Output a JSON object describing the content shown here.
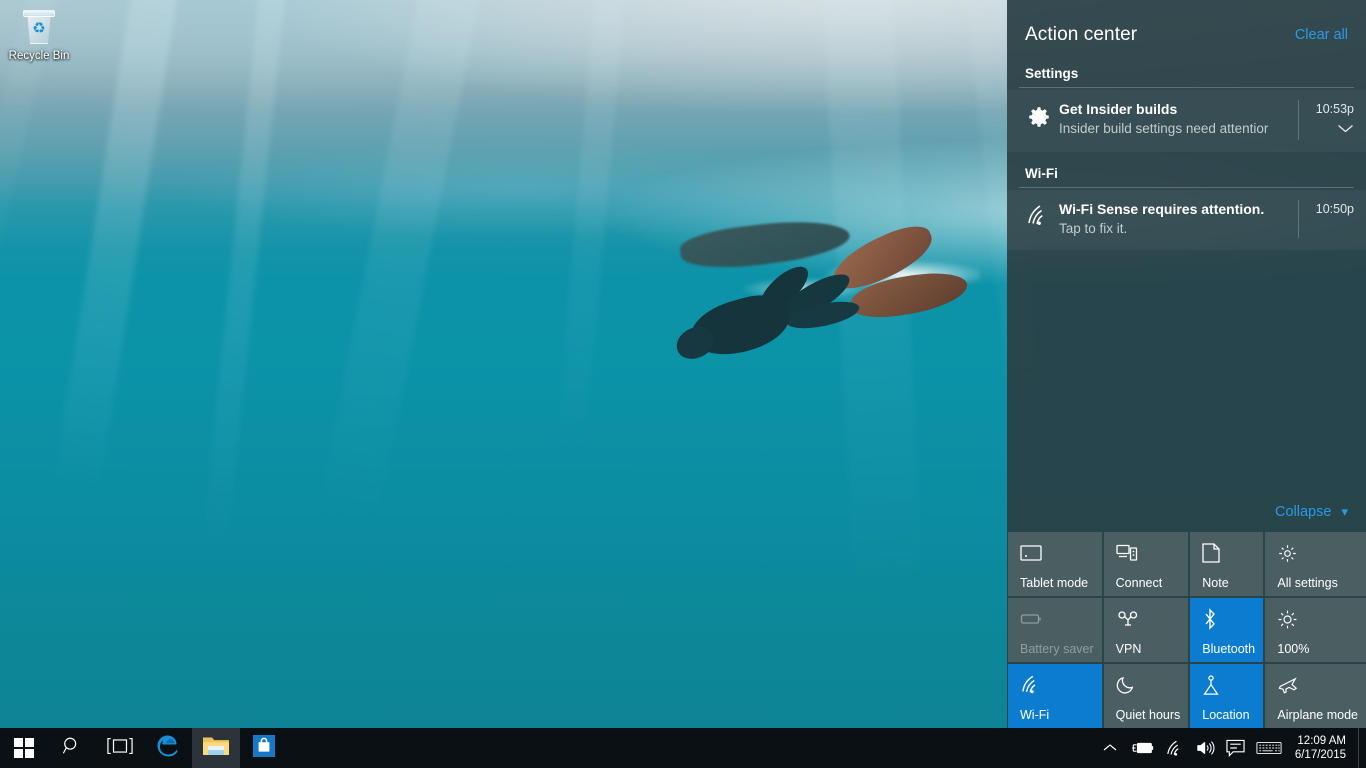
{
  "desktop": {
    "icons": [
      {
        "label": "Recycle Bin",
        "icon": "recycle-bin-icon"
      }
    ]
  },
  "action_center": {
    "title": "Action center",
    "clear_all_label": "Clear all",
    "collapse_label": "Collapse",
    "collapse_icon": "chevron-down-icon",
    "groups": [
      {
        "name": "Settings",
        "notifications": [
          {
            "icon": "gear-icon",
            "title": "Get Insider builds",
            "subtitle": "Insider build settings need attentior",
            "time": "10:53p",
            "expand_icon": "chevron-down-icon",
            "has_expand": true
          }
        ]
      },
      {
        "name": "Wi-Fi",
        "notifications": [
          {
            "icon": "wifi-icon",
            "title": "Wi-Fi Sense requires attention.",
            "subtitle": "Tap to fix it.",
            "time": "10:50p",
            "expand_icon": "",
            "has_expand": false
          }
        ]
      }
    ],
    "quick_actions": [
      {
        "label": "Tablet mode",
        "icon": "tablet-icon",
        "state": "off"
      },
      {
        "label": "Connect",
        "icon": "connect-icon",
        "state": "off"
      },
      {
        "label": "Note",
        "icon": "note-icon",
        "state": "off"
      },
      {
        "label": "All settings",
        "icon": "settings-gear-icon",
        "state": "off"
      },
      {
        "label": "Battery saver",
        "icon": "battery-icon",
        "state": "disabled"
      },
      {
        "label": "VPN",
        "icon": "vpn-icon",
        "state": "off"
      },
      {
        "label": "Bluetooth",
        "icon": "bluetooth-icon",
        "state": "on"
      },
      {
        "label": "100%",
        "icon": "brightness-icon",
        "state": "off"
      },
      {
        "label": "Wi-Fi",
        "icon": "wifi-icon",
        "state": "on"
      },
      {
        "label": "Quiet hours",
        "icon": "moon-icon",
        "state": "off"
      },
      {
        "label": "Location",
        "icon": "location-icon",
        "state": "on"
      },
      {
        "label": "Airplane mode",
        "icon": "airplane-icon",
        "state": "off"
      }
    ],
    "colors": {
      "panel_bg": "#2a4045",
      "tile_off": "#4b5f63",
      "tile_on": "#0b7cd0",
      "accent_link": "#2b9ae6"
    }
  },
  "taskbar": {
    "buttons": [
      {
        "name": "start-button",
        "icon": "windows-logo-icon",
        "active": false
      },
      {
        "name": "search-button",
        "icon": "search-icon",
        "active": false
      },
      {
        "name": "task-view-button",
        "icon": "task-view-icon",
        "active": false
      },
      {
        "name": "edge-button",
        "icon": "edge-icon",
        "active": false
      },
      {
        "name": "file-explorer-button",
        "icon": "folder-icon",
        "active": true
      },
      {
        "name": "store-button",
        "icon": "store-icon",
        "active": false
      }
    ],
    "tray": [
      {
        "name": "show-hidden-icons-button",
        "icon": "chevron-up-icon"
      },
      {
        "name": "battery-tray-icon",
        "icon": "battery-charging-icon"
      },
      {
        "name": "network-tray-icon",
        "icon": "wifi-icon"
      },
      {
        "name": "volume-tray-icon",
        "icon": "speaker-icon"
      },
      {
        "name": "action-center-tray-icon",
        "icon": "speech-bubble-icon"
      },
      {
        "name": "keyboard-tray-icon",
        "icon": "keyboard-icon"
      }
    ],
    "clock": {
      "time": "12:09 AM",
      "date": "6/17/2015"
    }
  }
}
